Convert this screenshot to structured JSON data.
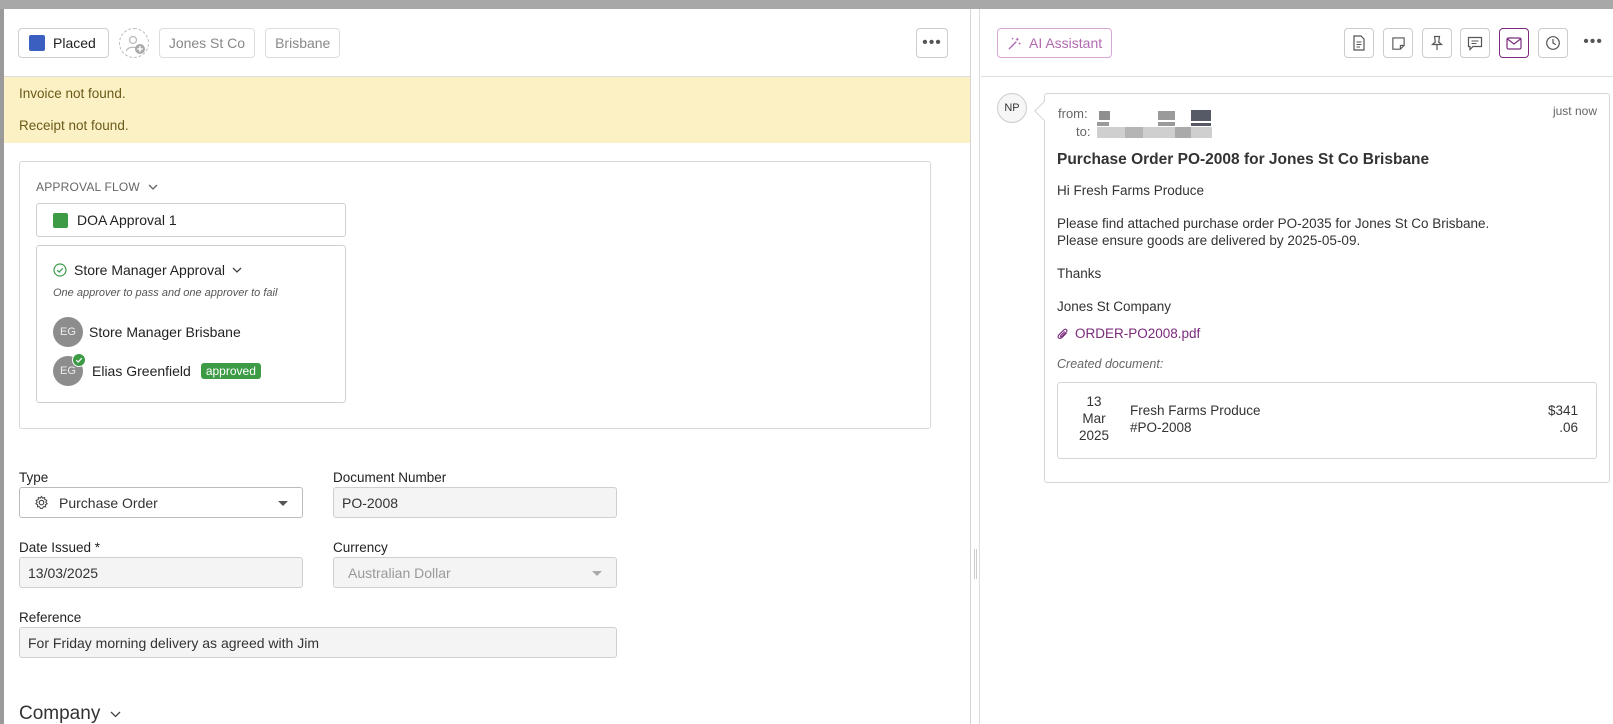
{
  "header": {
    "status_label": "Placed",
    "tags": [
      "Jones St Co",
      "Brisbane"
    ]
  },
  "banner": {
    "messages": [
      "Invoice not found.",
      "Receipt not found."
    ]
  },
  "approval": {
    "title": "APPROVAL FLOW",
    "doa_label": "DOA Approval 1",
    "step_title": "Store Manager Approval",
    "step_rule": "One approver to pass and one approver to fail",
    "approvers": [
      {
        "initials": "EG",
        "name": "Store Manager Brisbane",
        "badge": ""
      },
      {
        "initials": "EG",
        "name": "Elias Greenfield",
        "badge": "approved"
      }
    ]
  },
  "form": {
    "type_label": "Type",
    "type_value": "Purchase Order",
    "docnum_label": "Document Number",
    "docnum_value": "PO-2008",
    "date_label": "Date Issued *",
    "date_value": "13/03/2025",
    "currency_label": "Currency",
    "currency_value": "Australian Dollar",
    "reference_label": "Reference",
    "reference_value": "For Friday morning delivery as agreed with Jim",
    "company_heading": "Company"
  },
  "right": {
    "ai_label": "AI Assistant",
    "sender_initials": "NP",
    "from_label": "from:",
    "to_label": "to:",
    "time": "just now",
    "subject": "Purchase Order PO-2008 for Jones St Co Brisbane",
    "greeting": "Hi Fresh Farms Produce",
    "body1": "Please find attached purchase order PO-2035 for Jones St Co Brisbane.",
    "body2": "Please ensure goods are delivered by 2025-05-09.",
    "thanks": "Thanks",
    "signature": "Jones St Company",
    "attachment": "ORDER-PO2008.pdf",
    "created_label": "Created document:",
    "doc": {
      "day": "13",
      "month": "Mar",
      "year": "2025",
      "supplier": "Fresh Farms Produce",
      "number": "#PO-2008",
      "amount_whole": "$341",
      "amount_cents": ".06"
    }
  },
  "colors": {
    "status_blue": "#3b5fc0",
    "approved_green": "#3d9b46",
    "banner_yellow": "#fcf1c4",
    "accent_purple": "#7b2a7b"
  }
}
